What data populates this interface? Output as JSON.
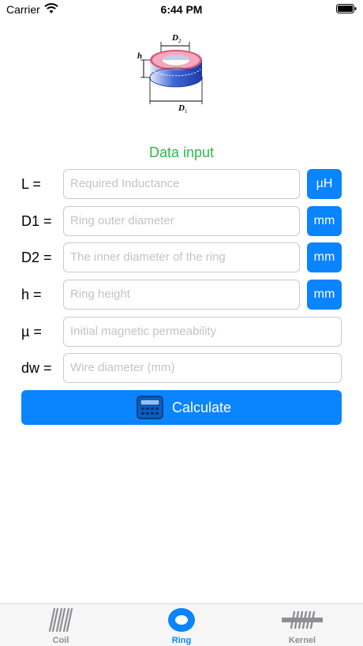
{
  "status_bar": {
    "carrier": "Carrier",
    "time": "6:44 PM"
  },
  "diagram_labels": {
    "d2": "D",
    "d2_sub": "2",
    "d1": "D",
    "d1_sub": "1",
    "h": "h"
  },
  "section_title": "Data input",
  "inputs": [
    {
      "label": "L =",
      "placeholder": "Required Inductance",
      "unit": "µH"
    },
    {
      "label": "D1 =",
      "placeholder": "Ring outer diameter",
      "unit": "mm"
    },
    {
      "label": "D2 =",
      "placeholder": "The inner diameter of the ring",
      "unit": "mm"
    },
    {
      "label": "h =",
      "placeholder": "Ring height",
      "unit": "mm"
    },
    {
      "label": "µ =",
      "placeholder": "Initial magnetic permeability"
    },
    {
      "label": "dw =",
      "placeholder": "Wire diameter (mm)"
    }
  ],
  "calculate_label": "Calculate",
  "tabs": [
    {
      "label": "Coil",
      "icon": "coil-icon"
    },
    {
      "label": "Ring",
      "icon": "ring-icon",
      "active": true
    },
    {
      "label": "Kernel",
      "icon": "kernel-icon"
    }
  ],
  "colors": {
    "accent": "#0a84ff",
    "title_green": "#2fb84a",
    "inactive_tab": "#8e8e93"
  }
}
